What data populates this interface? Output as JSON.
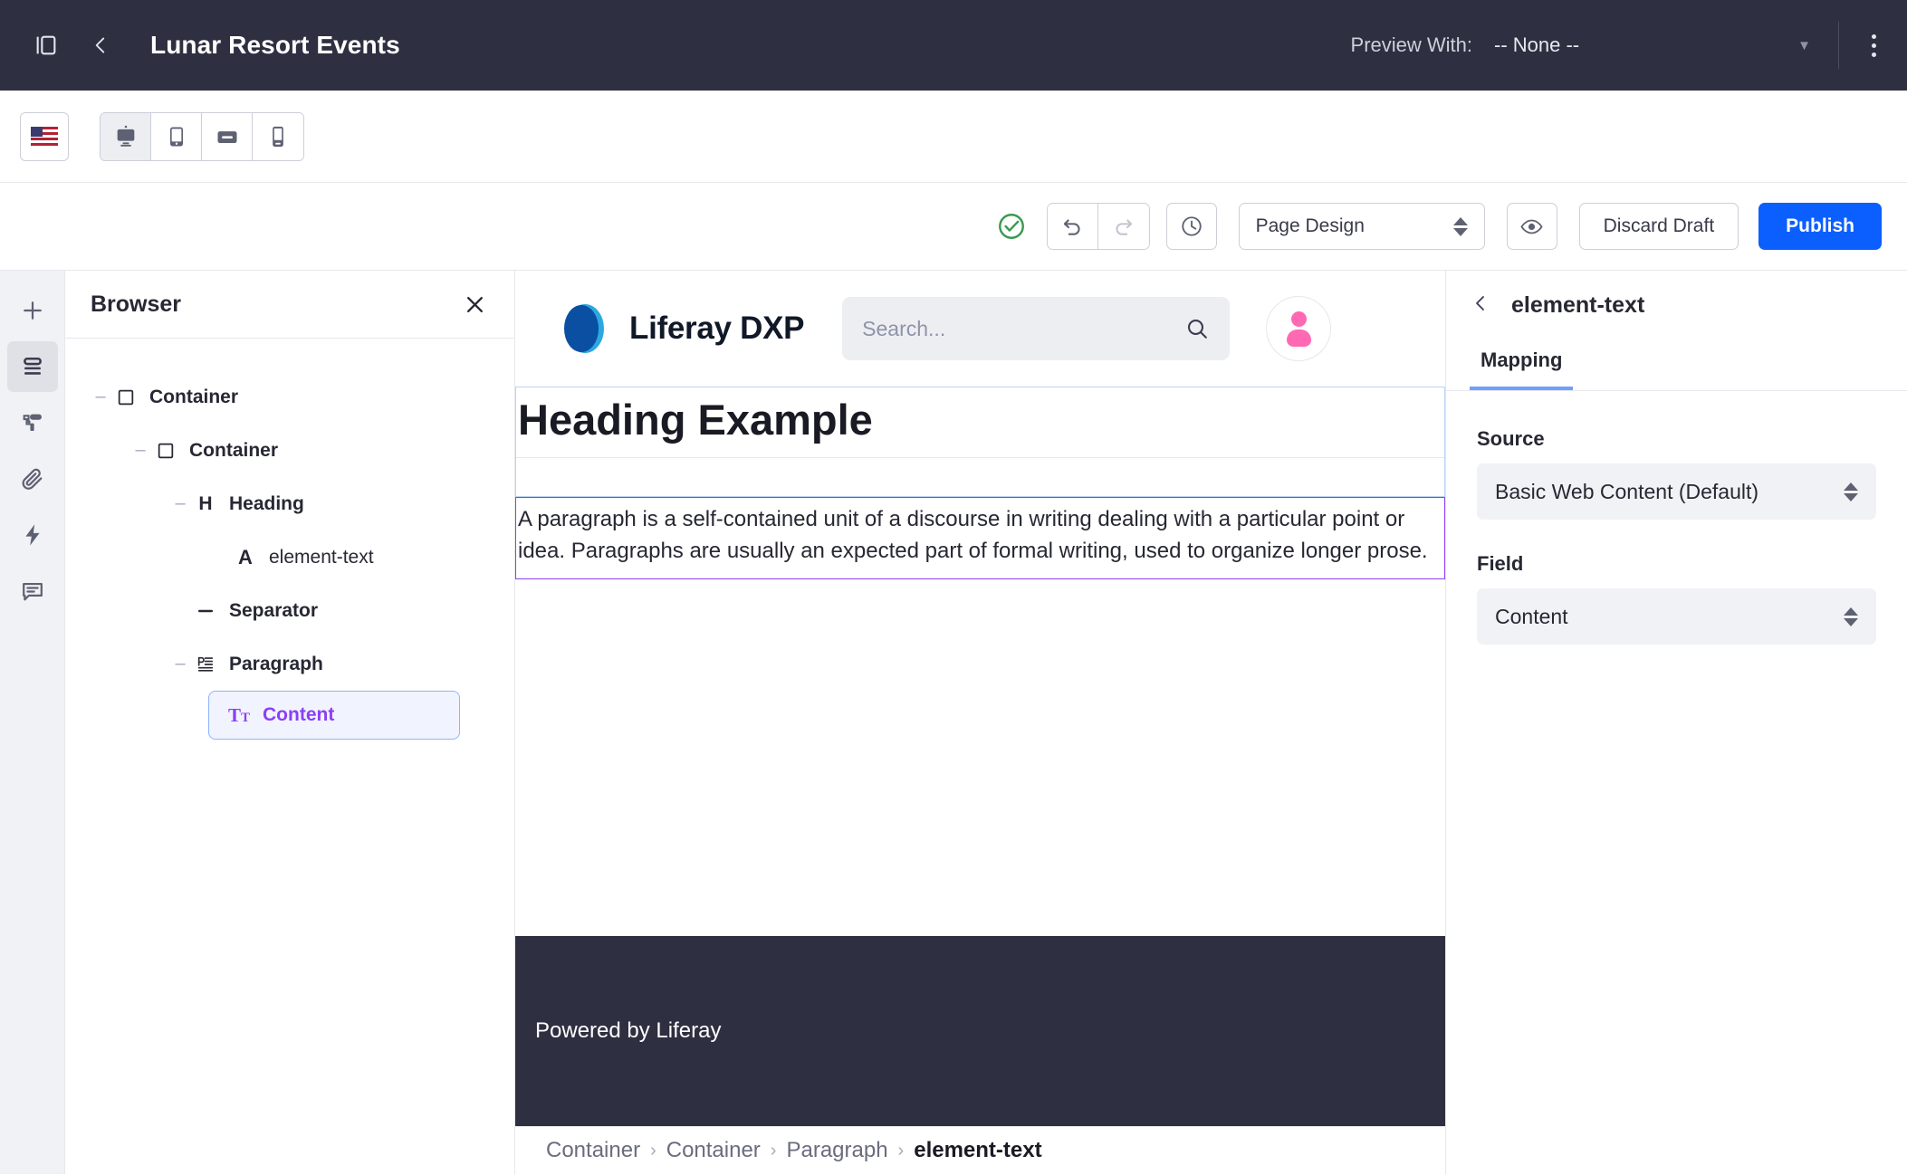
{
  "topbar": {
    "sidebar_toggle": "panel-toggle-icon",
    "back": "back-icon",
    "title": "Lunar Resort Events",
    "preview_label": "Preview With:",
    "preview_value": "-- None --",
    "kebab": "more-options-icon"
  },
  "devicebar": {
    "language": "en-US",
    "devices": [
      {
        "name": "desktop",
        "active": true
      },
      {
        "name": "tablet",
        "active": false
      },
      {
        "name": "tablet-landscape",
        "active": false
      },
      {
        "name": "mobile",
        "active": false
      }
    ]
  },
  "actionbar": {
    "status": "saved-check-icon",
    "undo": "undo-icon",
    "redo": "redo-icon",
    "history": "history-clock-icon",
    "page_design": "Page Design",
    "preview": "eye-icon",
    "discard_label": "Discard Draft",
    "publish_label": "Publish",
    "publish_color": "#0B5FFF"
  },
  "rail": {
    "items": [
      {
        "name": "add",
        "icon": "plus-icon",
        "active": false
      },
      {
        "name": "browser",
        "icon": "browser-layers-icon",
        "active": true
      },
      {
        "name": "styles",
        "icon": "paint-roller-icon",
        "active": false
      },
      {
        "name": "attachments",
        "icon": "paperclip-icon",
        "active": false
      },
      {
        "name": "automation",
        "icon": "lightning-icon",
        "active": false
      },
      {
        "name": "comments",
        "icon": "comment-icon",
        "active": false
      }
    ]
  },
  "browser": {
    "title": "Browser",
    "close": "close-icon",
    "tree": [
      {
        "label": "Container",
        "icon": "container-icon",
        "depth": 0,
        "toggle": "–",
        "bold": true,
        "selected": false
      },
      {
        "label": "Container",
        "icon": "container-icon",
        "depth": 1,
        "toggle": "–",
        "bold": true,
        "selected": false
      },
      {
        "label": "Heading",
        "icon": "heading-icon",
        "depth": 2,
        "toggle": "–",
        "bold": true,
        "selected": false
      },
      {
        "label": "element-text",
        "icon": "text-a-icon",
        "depth": 3,
        "toggle": "",
        "bold": false,
        "selected": false
      },
      {
        "label": "Separator",
        "icon": "separator-icon",
        "depth": 2,
        "toggle": "",
        "bold": true,
        "selected": false
      },
      {
        "label": "Paragraph",
        "icon": "paragraph-icon",
        "depth": 2,
        "toggle": "–",
        "bold": true,
        "selected": false
      },
      {
        "label": "Content",
        "icon": "text-tt-icon",
        "depth": 3,
        "toggle": "",
        "bold": true,
        "selected": true
      }
    ]
  },
  "canvas": {
    "brand": "Liferay DXP",
    "logo": "liferay-logo-icon",
    "search_placeholder": "Search...",
    "search_icon": "search-icon",
    "avatar": "user-avatar-icon",
    "heading": "Heading Example",
    "paragraph": "A paragraph is a self-contained unit of a discourse in writing dealing with a particular point or idea. Paragraphs are usually an expected part of formal writing, used to organize longer prose.",
    "heading_border_color": "#B9D4F5",
    "paragraph_border_color": "#8B3FF5",
    "footer_text": "Powered by Liferay",
    "footer_bg": "#2E3041",
    "breadcrumb": [
      {
        "label": "Container",
        "current": false
      },
      {
        "label": "Container",
        "current": false
      },
      {
        "label": "Paragraph",
        "current": false
      },
      {
        "label": "element-text",
        "current": true
      }
    ],
    "breadcrumb_separator": "›"
  },
  "right_panel": {
    "back": "back-icon",
    "title": "element-text",
    "tabs": [
      {
        "label": "Mapping",
        "active": true
      }
    ],
    "source_label": "Source",
    "source_value": "Basic Web Content (Default)",
    "field_label": "Field",
    "field_value": "Content"
  }
}
